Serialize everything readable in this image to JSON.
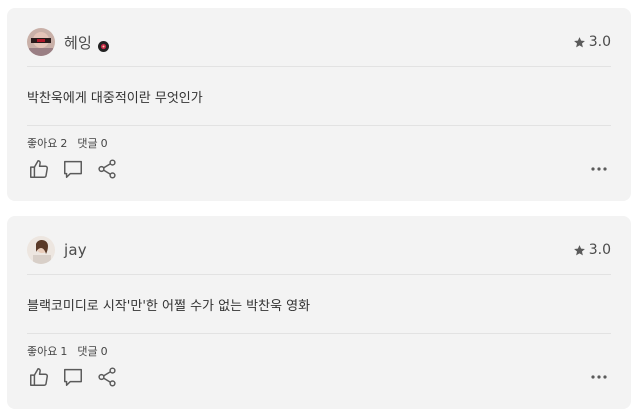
{
  "reviews": [
    {
      "username": "헤잉",
      "rating": "3.0",
      "text": "박찬욱에게 대중적이란 무엇인가",
      "likes_label": "좋아요",
      "likes_count": "2",
      "comments_label": "댓글",
      "comments_count": "0",
      "has_badge": true
    },
    {
      "username": "jay",
      "rating": "3.0",
      "text": "블랙코미디로 시작'만'한 어쩔 수가 없는 박찬욱 영화",
      "likes_label": "좋아요",
      "likes_count": "1",
      "comments_label": "댓글",
      "comments_count": "0",
      "has_badge": false
    }
  ],
  "icons": {
    "rating": "star-icon",
    "like": "thumbs-up-icon",
    "comment": "comment-icon",
    "share": "share-icon",
    "more": "more-dots-icon",
    "badge": "verified-badge-icon"
  },
  "colors": {
    "card_background": "#f3f3f3",
    "icon": "#5a5a5a",
    "star": "#5a5a5a"
  }
}
